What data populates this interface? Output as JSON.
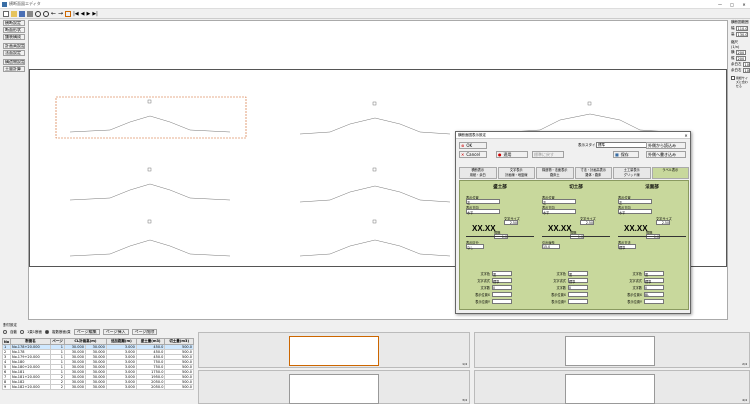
{
  "window": {
    "title": "横断面図エディタ"
  },
  "controls": {
    "min": "—",
    "max": "□",
    "close": "✕"
  },
  "toolbar": {
    "items": [
      "new-icon",
      "open-icon",
      "save-icon",
      "print-icon",
      "zoom-in-icon",
      "zoom-out-icon",
      "undo-icon",
      "redo-icon",
      "fit-icon",
      "first-icon",
      "prev-icon",
      "next-icon",
      "last-icon"
    ]
  },
  "left_tools": {
    "items": [
      "横断設定",
      "断面形状",
      "舗装構成",
      "計画高設定",
      "法面設定",
      "構造物設定",
      "土量計算"
    ]
  },
  "right_panel": {
    "title": "横断図範囲",
    "w_label": "幅",
    "w_value": "110.000",
    "h_label": "高",
    "h_value": "130.000",
    "scale_title": "縮尺",
    "scale_sub": "(1/n)",
    "rows": [
      {
        "label": "横",
        "value": "200"
      },
      {
        "label": "縦",
        "value": "200"
      },
      {
        "label": "余白左",
        "value": "10"
      },
      {
        "label": "余白右",
        "value": "10"
      }
    ],
    "check_label": "用紙サイズに合わせる"
  },
  "canvas": {
    "sections": [
      {
        "id": "1"
      },
      {
        "id": "2"
      },
      {
        "id": "3"
      },
      {
        "id": "4"
      },
      {
        "id": "5"
      },
      {
        "id": "6"
      },
      {
        "id": "7"
      },
      {
        "id": "8"
      },
      {
        "id": "9"
      }
    ]
  },
  "bottom": {
    "layout_title": "割付設定",
    "radio_auto": "自動",
    "radio_one": "1頁1断面",
    "radio_many": "複数断面/頁",
    "btn_edit": "ページ編集",
    "btn_insert": "ページ挿入",
    "btn_delete": "ページ削除",
    "table": {
      "headers": [
        "No",
        "断面名",
        "ページ",
        "CL計画高(m)",
        "追加距離(m)",
        "盛土量(m3)",
        "切土量(m3)"
      ],
      "rows": [
        [
          "1",
          "No.178+20.000",
          "1",
          "30.000",
          "30.000",
          "3.000",
          "450.0",
          "500.0"
        ],
        [
          "2",
          "No.178",
          "1",
          "30.000",
          "30.000",
          "3.000",
          "450.0",
          "500.0"
        ],
        [
          "3",
          "No.179+20.000",
          "1",
          "30.000",
          "30.000",
          "3.000",
          "450.0",
          "500.0"
        ],
        [
          "4",
          "No.180",
          "1",
          "30.000",
          "30.000",
          "3.000",
          "750.0",
          "500.0"
        ],
        [
          "5",
          "No.180+20.000",
          "1",
          "30.000",
          "30.000",
          "3.000",
          "750.0",
          "500.0"
        ],
        [
          "6",
          "No.181",
          "1",
          "30.000",
          "30.000",
          "3.000",
          "1750.0",
          "500.0"
        ],
        [
          "7",
          "No.181+20.000",
          "2",
          "30.000",
          "30.000",
          "3.000",
          "1950.0",
          "500.0"
        ],
        [
          "8",
          "No.182",
          "2",
          "30.000",
          "30.000",
          "3.000",
          "2050.0",
          "500.0"
        ],
        [
          "9",
          "No.182+20.000",
          "2",
          "30.000",
          "30.000",
          "3.000",
          "2050.0",
          "500.0"
        ]
      ]
    },
    "thumb_labels": [
      "1/4",
      "2/4",
      "3/4",
      "4/4"
    ]
  },
  "dialog": {
    "title": "横断面図表示設定",
    "buttons": {
      "ok": "OK",
      "cancel": "Cancel",
      "apply": "適用",
      "reset": "標準に戻す",
      "edit": "項目を編集",
      "preset": "既定値に設定"
    },
    "style_label": "表示スタイル",
    "style_value": "標準",
    "save": "保存",
    "load": "読込み",
    "right_btn1": "外側から読込み",
    "right_btn2": "外側へ書き込み",
    "tabs": [
      [
        "横断表示",
        "用紙・余白"
      ],
      [
        "文字表示",
        "計画線・地盤線"
      ],
      [
        "構造物・法面表示",
        "路床土"
      ],
      [
        "寸法・計画高表示",
        "路体・路床"
      ],
      [
        "土工量表示",
        "グリッド線"
      ],
      [
        "ラベル表示",
        ""
      ]
    ],
    "columns": [
      {
        "title": "盛土部",
        "label1": "表示位置",
        "val1": "左",
        "label2": "表示方向",
        "val2": "水平",
        "sample": "XX.XX",
        "size_label": "文字サイズ",
        "size_val": "2.50",
        "gap_label": "間隔",
        "gap_val": "1.0",
        "extra_label": "表示区分",
        "extra_val": "なし"
      },
      {
        "title": "切土部",
        "label1": "表示位置",
        "val1": "左",
        "label2": "表示方向",
        "val2": "水平",
        "sample": "XX.XX",
        "size_label": "文字サイズ",
        "size_val": "2.50",
        "gap_label": "間隔",
        "gap_val": "1.0",
        "extra_label": "引出線長",
        "extra_val": "15.0"
      },
      {
        "title": "法面部",
        "label1": "表示位置",
        "val1": "左",
        "label2": "表示方向",
        "val2": "水平",
        "sample": "XX.XX",
        "size_label": "文字サイズ",
        "size_val": "2.50",
        "gap_label": "間隔",
        "gap_val": "1.0",
        "extra_label": "表示方法",
        "extra_val": "標準"
      }
    ],
    "bottom_fields": [
      {
        "label": "文字色",
        "val": "黒"
      },
      {
        "label": "文字書式",
        "val": "標準"
      },
      {
        "label": "文字数",
        "val": "0"
      },
      {
        "label": "表示位置X",
        "val": ""
      },
      {
        "label": "表示位置Y",
        "val": ""
      }
    ],
    "bottom_fields2": [
      {
        "label": "文字色",
        "val": "黒"
      },
      {
        "label": "文字書式",
        "val": "標準"
      },
      {
        "label": "文字数",
        "val": "0"
      },
      {
        "label": "表示位置X",
        "val": ""
      },
      {
        "label": "表示位置Y",
        "val": ""
      }
    ],
    "bottom_fields3": [
      {
        "label": "文字色",
        "val": "黒"
      },
      {
        "label": "文字書式",
        "val": "標準"
      },
      {
        "label": "文字数",
        "val": "0"
      },
      {
        "label": "表示位置X",
        "val": "BL"
      },
      {
        "label": "表示位置Y",
        "val": ""
      }
    ],
    "accent": "#c8d89c"
  }
}
